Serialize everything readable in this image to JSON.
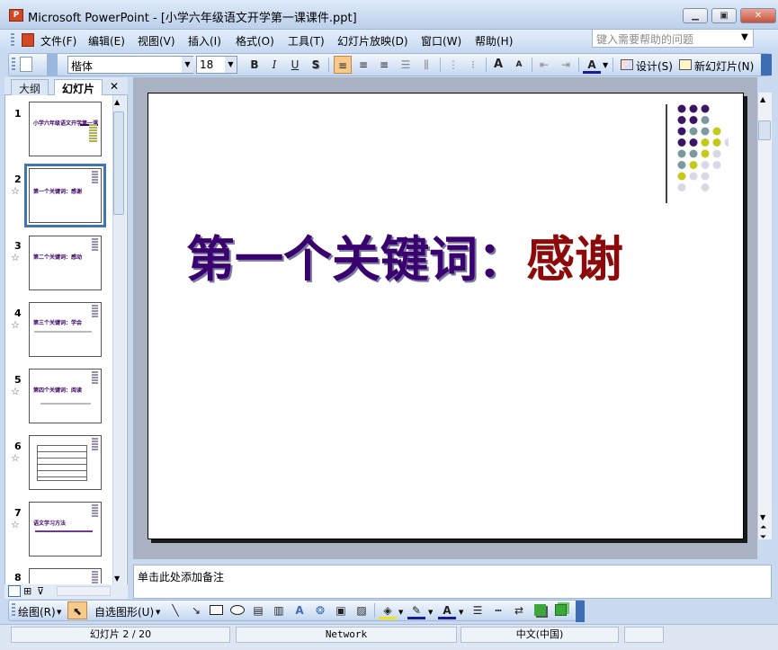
{
  "window": {
    "app_icon_label": "P",
    "title": "Microsoft PowerPoint - [小学六年级语文开学第一课课件.ppt]",
    "minimize": "▁",
    "maximize": "▣",
    "close": "✕"
  },
  "menu": {
    "items": [
      "文件(F)",
      "编辑(E)",
      "视图(V)",
      "插入(I)",
      "格式(O)",
      "工具(T)",
      "幻灯片放映(D)",
      "窗口(W)",
      "帮助(H)"
    ],
    "help_placeholder": "键入需要帮助的问题"
  },
  "toolbar": {
    "font_name": "楷体",
    "font_size": "18",
    "bold": "B",
    "italic": "I",
    "underline": "U",
    "shadow": "S",
    "font_grow": "A",
    "font_shrink": "A",
    "font_color": "A",
    "design_label": "设计(S)",
    "new_slide_label": "新幻灯片(N)"
  },
  "panel_tabs": {
    "outline": "大纲",
    "slides": "幻灯片",
    "close": "✕"
  },
  "thumbnails": [
    {
      "number": "1",
      "text": "小学六年级语文开学第一课"
    },
    {
      "number": "2",
      "text": "第一个关键词：感谢"
    },
    {
      "number": "3",
      "text": "第二个关键词：感动"
    },
    {
      "number": "4",
      "text": "第三个关键词：学会"
    },
    {
      "number": "5",
      "text": "第四个关键词：阅读"
    },
    {
      "number": "6",
      "text": ""
    },
    {
      "number": "7",
      "text": "语文学习方法"
    },
    {
      "number": "8",
      "text": ""
    }
  ],
  "slide": {
    "title_main": "第一个关键词：",
    "title_keyword": "感谢",
    "dot_colors": [
      "#3b1466",
      "#7a9aa0",
      "#c6c81a",
      "#d8d8e6"
    ]
  },
  "notes": {
    "placeholder": "单击此处添加备注"
  },
  "drawing_toolbar": {
    "draw_label": "绘图(R)",
    "autoshapes_label": "自选图形(U)"
  },
  "status": {
    "slide_position": "幻灯片 2 / 20",
    "design": "Network",
    "language": "中文(中国)"
  }
}
